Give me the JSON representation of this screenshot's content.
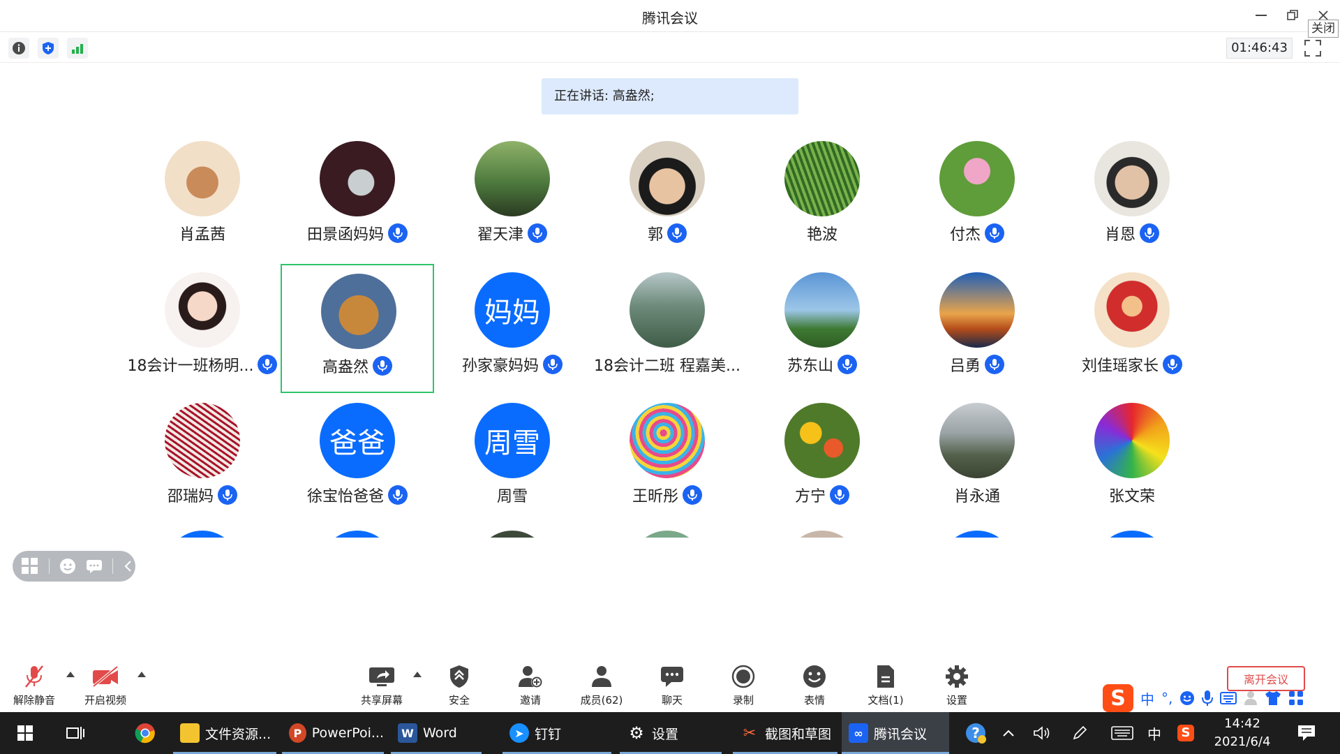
{
  "window": {
    "title": "腾讯会议",
    "close_tooltip": "关闭"
  },
  "toolbar": {
    "timer": "01:46:43",
    "icons": [
      "info-icon",
      "shield-icon",
      "signal-icon"
    ]
  },
  "speaking": {
    "text": "正在讲话: 高盎然;"
  },
  "participants": [
    {
      "name": "肖孟茜",
      "mic": false,
      "avatar": "bubble-tea-icon"
    },
    {
      "name": "田景函妈妈",
      "mic": true,
      "avatar": "jade-pendant-photo"
    },
    {
      "name": "翟天津",
      "mic": true,
      "avatar": "man-in-park-photo"
    },
    {
      "name": "郭",
      "mic": true,
      "avatar": "child-photo"
    },
    {
      "name": "艳波",
      "mic": false,
      "avatar": "plant-photo"
    },
    {
      "name": "付杰",
      "mic": true,
      "avatar": "lotus-photo"
    },
    {
      "name": "肖恩",
      "mic": true,
      "avatar": "boy-photo"
    },
    {
      "name": "18会计一班杨明...",
      "mic": true,
      "avatar": "cartoon-girl"
    },
    {
      "name": "高盎然",
      "mic": true,
      "avatar": "golden-dog-photo",
      "active": true
    },
    {
      "name": "孙家豪妈妈",
      "mic": true,
      "avatar_text": "妈妈"
    },
    {
      "name": "18会计二班 程嘉美...",
      "mic": false,
      "avatar": "opera-house-photo"
    },
    {
      "name": "苏东山",
      "mic": true,
      "avatar": "tower-photo"
    },
    {
      "name": "吕勇",
      "mic": true,
      "avatar": "sunset-photo"
    },
    {
      "name": "刘佳瑶家长",
      "mic": true,
      "avatar": "deity-painting"
    },
    {
      "name": "邵瑞妈",
      "mic": true,
      "avatar": "saffron-photo"
    },
    {
      "name": "徐宝怡爸爸",
      "mic": true,
      "avatar_text": "爸爸"
    },
    {
      "name": "周雪",
      "mic": false,
      "avatar_text": "周雪"
    },
    {
      "name": "王昕彤",
      "mic": true,
      "avatar": "lollipop-photo"
    },
    {
      "name": "方宁",
      "mic": true,
      "avatar": "flowers-photo"
    },
    {
      "name": "肖永通",
      "mic": false,
      "avatar": "mountain-photo"
    },
    {
      "name": "张文荣",
      "mic": false,
      "avatar": "rainbow-rose-photo"
    }
  ],
  "controls": {
    "unmute": "解除静音",
    "start_video": "开启视频",
    "share_screen": "共享屏幕",
    "security": "安全",
    "invite": "邀请",
    "members": "成员(62)",
    "chat": "聊天",
    "record": "录制",
    "emoji": "表情",
    "docs": "文档(1)",
    "settings": "设置",
    "leave": "离开会议"
  },
  "ime": {
    "lang": "中",
    "punct": "°,"
  },
  "taskbar": {
    "items": [
      {
        "label": "文件资源..."
      },
      {
        "label": "PowerPoi..."
      },
      {
        "label": "Word"
      },
      {
        "label": "钉钉"
      },
      {
        "label": "设置"
      },
      {
        "label": "截图和草图"
      },
      {
        "label": "腾讯会议"
      }
    ],
    "tray_lang": "中",
    "time": "14:42",
    "date": "2021/6/4"
  }
}
